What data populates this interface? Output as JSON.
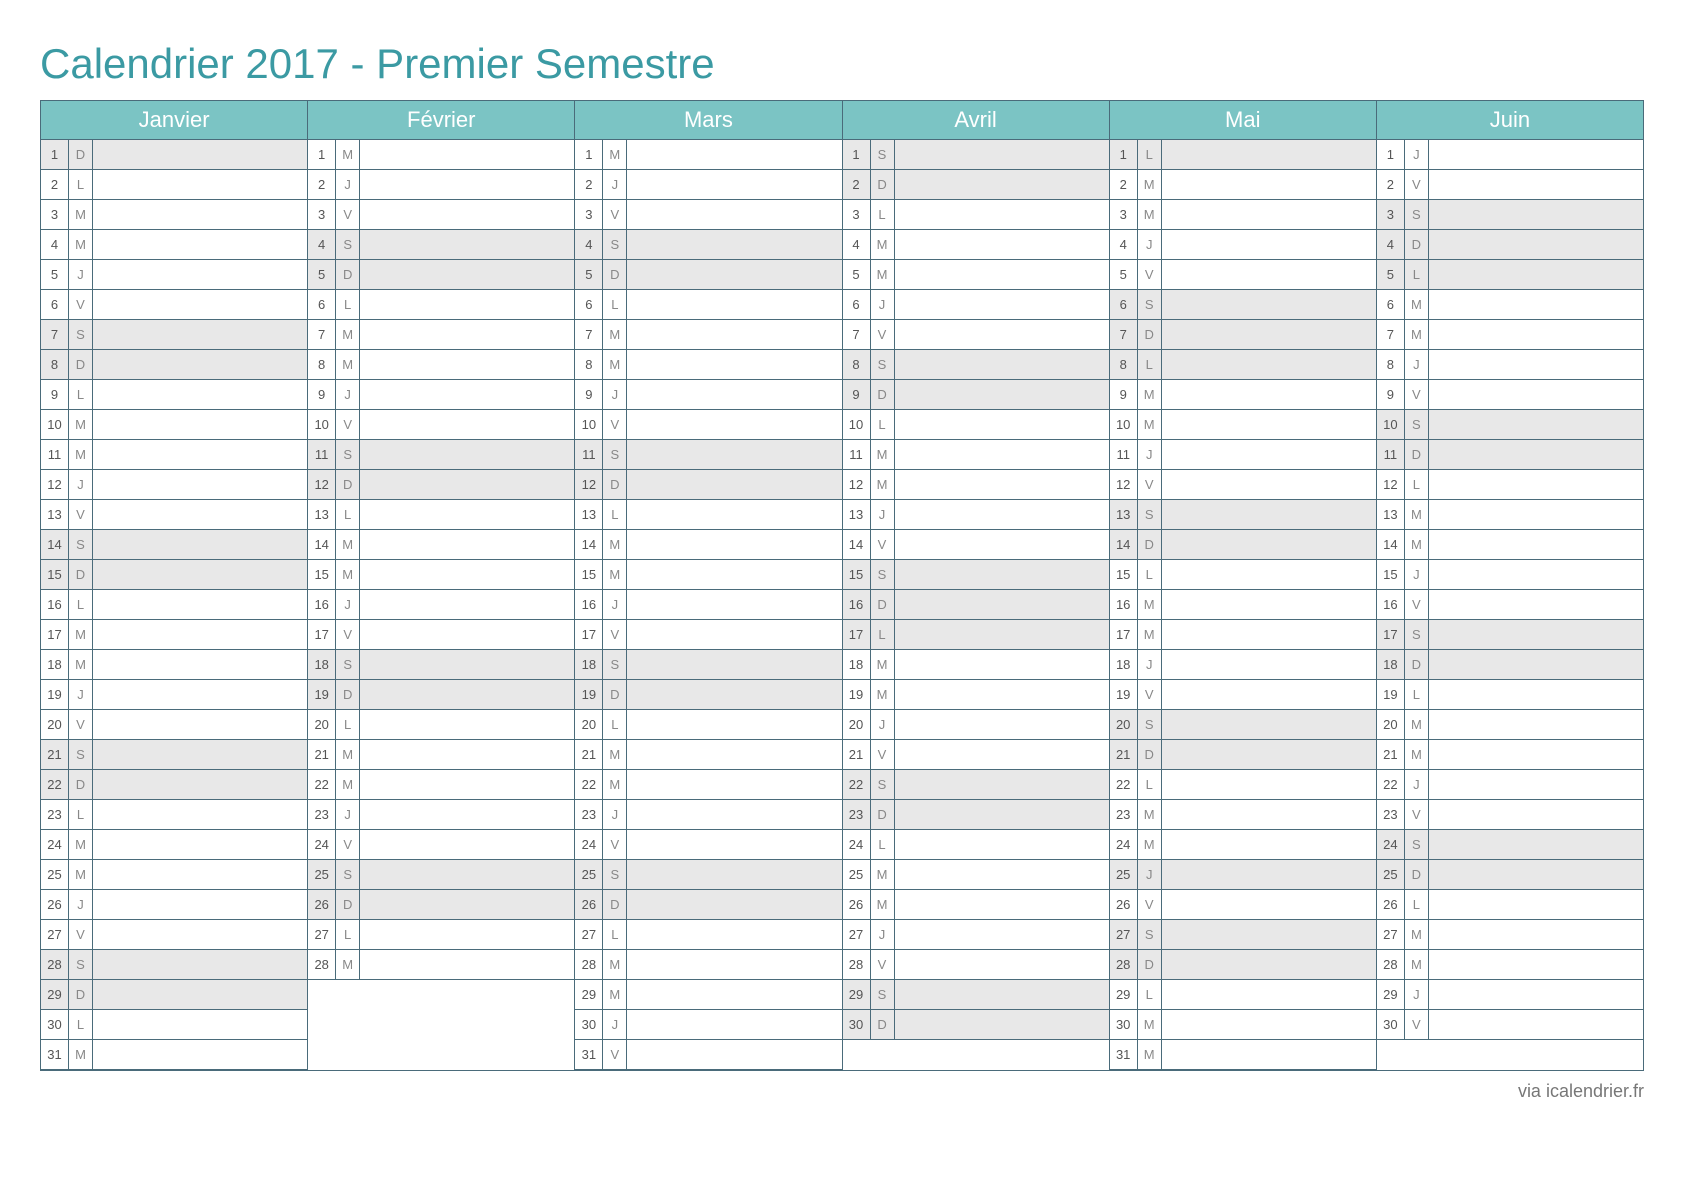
{
  "title": "Calendrier 2017 - Premier Semestre",
  "footer": "via icalendrier.fr",
  "months": [
    {
      "name": "Janvier",
      "start": 0,
      "count": 31
    },
    {
      "name": "Février",
      "start": 3,
      "count": 28
    },
    {
      "name": "Mars",
      "start": 3,
      "count": 31
    },
    {
      "name": "Avril",
      "start": 6,
      "count": 30
    },
    {
      "name": "Mai",
      "start": 1,
      "count": 31
    },
    {
      "name": "Juin",
      "start": 4,
      "count": 30
    }
  ],
  "dow": [
    "D",
    "L",
    "M",
    "M",
    "J",
    "V",
    "S"
  ],
  "shadedHolidays": {
    "Janvier": [
      1
    ],
    "Avril": [
      17
    ],
    "Mai": [
      1,
      8,
      25
    ],
    "Juin": [
      5
    ]
  }
}
